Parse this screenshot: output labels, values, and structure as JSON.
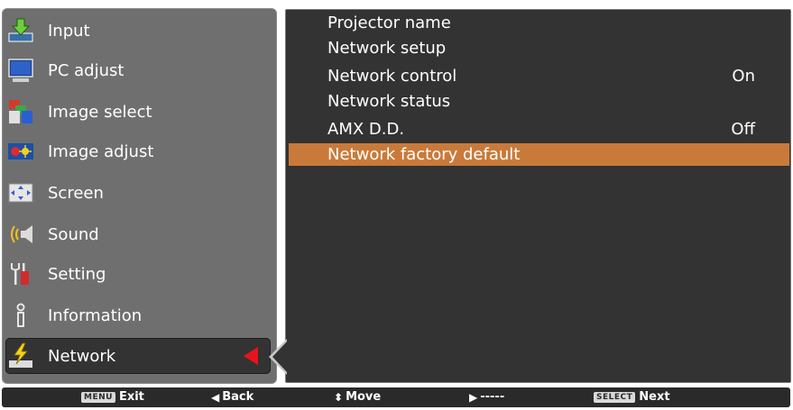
{
  "menu": {
    "items": [
      {
        "label": "Input",
        "icon": "input-icon"
      },
      {
        "label": "PC adjust",
        "icon": "pc-adjust-icon"
      },
      {
        "label": "Image select",
        "icon": "image-select-icon"
      },
      {
        "label": "Image adjust",
        "icon": "image-adjust-icon"
      },
      {
        "label": "Screen",
        "icon": "screen-icon"
      },
      {
        "label": "Sound",
        "icon": "sound-icon"
      },
      {
        "label": "Setting",
        "icon": "setting-icon"
      },
      {
        "label": "Information",
        "icon": "information-icon"
      },
      {
        "label": "Network",
        "icon": "network-icon"
      }
    ],
    "selected": "Network"
  },
  "submenu": {
    "items": [
      {
        "label": "Projector name",
        "value": ""
      },
      {
        "label": "Network setup",
        "value": ""
      },
      {
        "label": "Network control",
        "value": "On"
      },
      {
        "label": "Network status",
        "value": ""
      },
      {
        "label": "AMX D.D.",
        "value": "Off"
      },
      {
        "label": "Network factory default",
        "value": ""
      }
    ],
    "highlighted": "Network factory default"
  },
  "footer": {
    "exit_key": "MENU",
    "exit_label": "Exit",
    "back_label": "Back",
    "move_label": "Move",
    "next_dash_label": "-----",
    "select_key": "SELECT",
    "next_label": "Next"
  },
  "colors": {
    "left_panel": "#6f6f6f",
    "right_panel": "#333333",
    "highlight": "#c97a3a",
    "selected_item": "#333333",
    "selection_arrow": "#e8141c"
  }
}
